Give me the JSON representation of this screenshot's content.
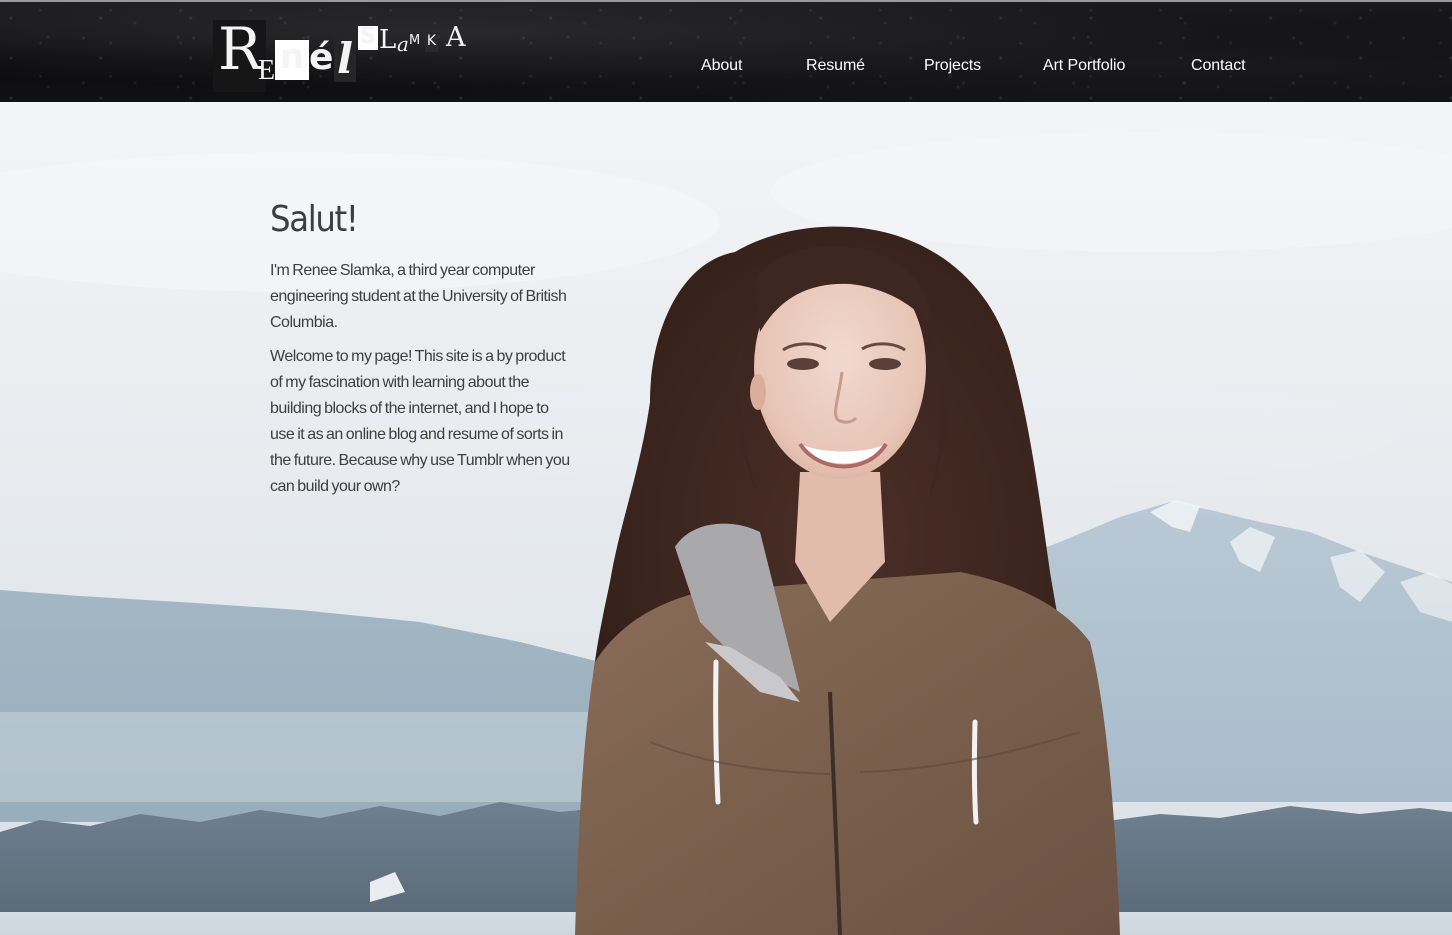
{
  "site": {
    "logo_text": "RenéeSLamka",
    "logo_glyphs": [
      "R",
      "E",
      "n",
      "é",
      "l",
      "S",
      "L",
      "a",
      "M",
      "K",
      "A"
    ]
  },
  "nav": {
    "items": [
      {
        "label": "About"
      },
      {
        "label": "Resumé"
      },
      {
        "label": "Projects"
      },
      {
        "label": "Art Portfolio"
      },
      {
        "label": "Contact"
      }
    ]
  },
  "intro": {
    "heading": "Salut!",
    "paragraph_1": "I'm Renee Slamka, a third year computer engineering student at the University of British Columbia.",
    "paragraph_2": "Welcome to my page! This site is a by product of my fascination with learning about the building blocks of the internet, and I hope to use it as an online blog and resume of sorts in the future. Because why use Tumblr when you can build your own?"
  },
  "colors": {
    "header_bg": "#0b0b0c",
    "nav_text": "#ffffff",
    "body_text": "#3e3e3e",
    "sky": "#eef0f2",
    "mountains": "#9fb3c2",
    "jacket": "#7e6452",
    "hair": "#3a2620"
  },
  "hero_image": {
    "subject": "portrait-photo",
    "background": "mountains-and-water-photo"
  }
}
